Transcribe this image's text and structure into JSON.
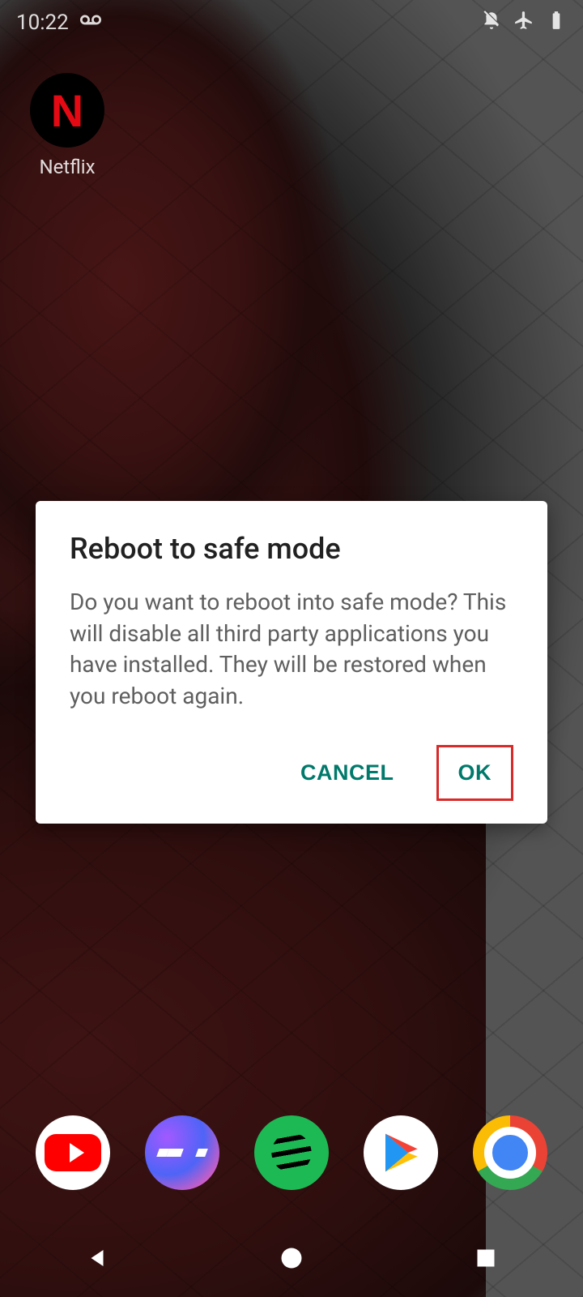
{
  "statusbar": {
    "time": "10:22",
    "voicemail_icon": "voicemail-icon",
    "dnd_icon": "notifications-off-icon",
    "airplane_icon": "airplane-mode-icon",
    "battery_icon": "battery-icon"
  },
  "home": {
    "apps": [
      {
        "name": "Netflix",
        "icon_letter": "N"
      }
    ]
  },
  "dock": {
    "items": [
      "YouTube",
      "Messenger",
      "Spotify",
      "Play Store",
      "Chrome"
    ]
  },
  "dialog": {
    "title": "Reboot to safe mode",
    "message": "Do you want to reboot into safe mode? This will disable all third party applications you have installed. They will be restored when you reboot again.",
    "cancel_label": "CANCEL",
    "ok_label": "OK"
  },
  "navbar": {
    "back": "back",
    "home": "home",
    "recent": "recent"
  },
  "colors": {
    "dialog_accent": "#00796b",
    "highlight_border": "#d92a2a"
  }
}
